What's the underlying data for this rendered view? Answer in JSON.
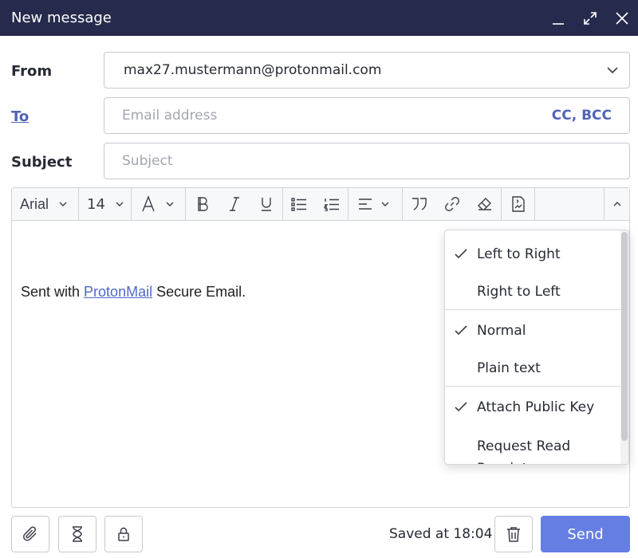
{
  "window": {
    "title": "New message"
  },
  "from": {
    "label": "From",
    "value": "max27.mustermann@protonmail.com"
  },
  "to": {
    "label": "To",
    "placeholder": "Email address",
    "cc_bcc": "CC, BCC"
  },
  "subject": {
    "label": "Subject",
    "placeholder": "Subject"
  },
  "toolbar": {
    "font": "Arial",
    "size": "14"
  },
  "body": {
    "prefix": "Sent with ",
    "link": "ProtonMail",
    "suffix": " Secure Email."
  },
  "menu": {
    "items": [
      {
        "label": "Left to Right",
        "checked": true
      },
      {
        "label": "Right to Left",
        "checked": false
      },
      {
        "label": "Normal",
        "checked": true
      },
      {
        "label": "Plain text",
        "checked": false
      },
      {
        "label": "Attach Public Key",
        "checked": true
      },
      {
        "label": "Request Read Receipt",
        "checked": false
      }
    ]
  },
  "footer": {
    "saved": "Saved at 18:04",
    "send": "Send"
  },
  "colors": {
    "titlebar": "#262a4d",
    "accent": "#5064b5",
    "send": "#657ee4"
  }
}
